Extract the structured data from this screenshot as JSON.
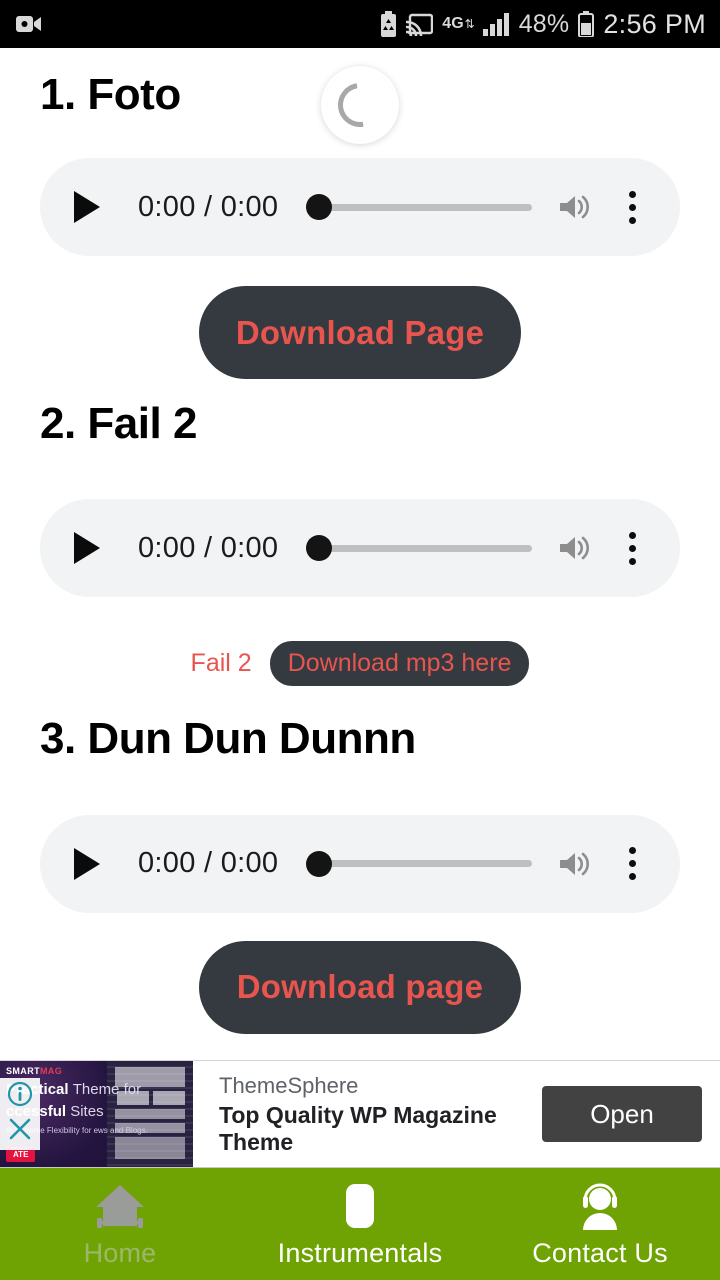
{
  "statusbar": {
    "left_icons": [
      "video-camera-icon"
    ],
    "right_icons": [
      "battery-saver-icon",
      "cast-icon",
      "signal-bars-icon",
      "battery-icon"
    ],
    "network_label": "4G",
    "battery_percent": "48%",
    "clock": "2:56 PM"
  },
  "colors": {
    "nav_green": "#6fa203",
    "button_dark": "#343a40",
    "accent_red": "#e8554e",
    "player_bg": "#f1f3f4",
    "ad_open_bg": "#424242"
  },
  "tracks": [
    {
      "title": "1. Foto",
      "player": {
        "current_time": "0:00",
        "duration": "0:00",
        "time_display": "0:00 / 0:00",
        "play_icon": "play-icon",
        "volume_icon": "volume-icon",
        "menu_icon": "more-vertical-icon",
        "progress_percent": 0
      },
      "spinner": {
        "visible": true,
        "icon": "loading-spinner-icon"
      },
      "download_button": "Download Page",
      "download_style": "large"
    },
    {
      "title": "2. Fail 2",
      "player": {
        "current_time": "0:00",
        "duration": "0:00",
        "time_display": "0:00 / 0:00",
        "play_icon": "play-icon",
        "volume_icon": "volume-icon",
        "menu_icon": "more-vertical-icon",
        "progress_percent": 0
      },
      "spinner": {
        "visible": false
      },
      "inline_label": "Fail 2",
      "download_button": "Download mp3 here",
      "download_style": "pill"
    },
    {
      "title": "3. Dun Dun Dunnn",
      "player": {
        "current_time": "0:00",
        "duration": "0:00",
        "time_display": "0:00 / 0:00",
        "play_icon": "play-icon",
        "volume_icon": "volume-icon",
        "menu_icon": "more-vertical-icon",
        "progress_percent": 0
      },
      "spinner": {
        "visible": false
      },
      "download_button": "Download page",
      "download_style": "large"
    }
  ],
  "ad": {
    "advertiser": "ThemeSphere",
    "headline": "Top Quality WP Magazine Theme",
    "cta_label": "Open",
    "info_icon": "info-icon",
    "close_icon": "close-icon",
    "creative": {
      "logo_first": "SMART",
      "logo_second": "MAG",
      "line1_bold": "Practical",
      "line1_thin": "Theme for",
      "line2_bold": "ccessful",
      "line2_thin": "Sites",
      "subline": "th Extreme Flexibility for ews and Blogs.",
      "button": "ATE"
    }
  },
  "bottom_nav": {
    "items": [
      {
        "label": "Home",
        "icon": "home-icon",
        "active": false
      },
      {
        "label": "Instrumentals",
        "icon": "instrumentals-icon",
        "active": true
      },
      {
        "label": "Contact Us",
        "icon": "headset-person-icon",
        "active": true
      }
    ]
  }
}
